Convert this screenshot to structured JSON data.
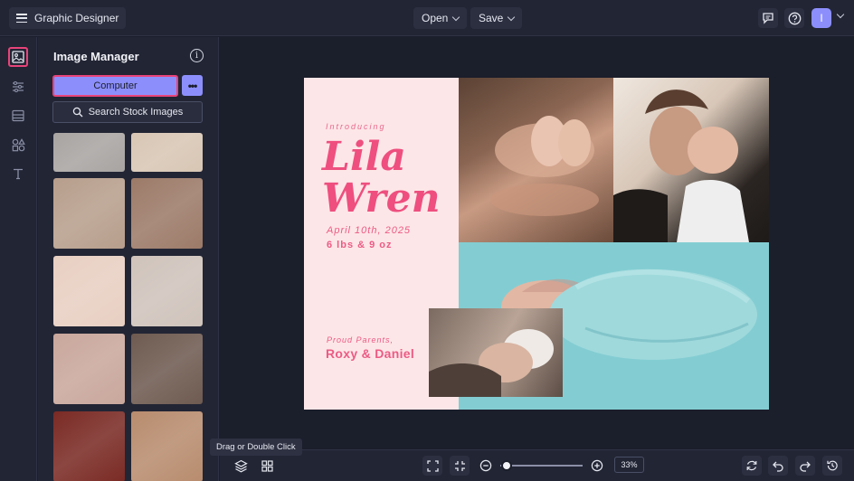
{
  "topbar": {
    "app_title": "Graphic Designer",
    "open_label": "Open",
    "save_label": "Save",
    "avatar_initial": "I"
  },
  "rail": {
    "items": [
      "image-manager",
      "adjustments",
      "layouts",
      "graphics",
      "text"
    ]
  },
  "panel": {
    "title": "Image Manager",
    "computer_label": "Computer",
    "more_label": "•••",
    "search_label": "Search Stock Images",
    "thumbnails": [
      {
        "name": "baby-sleeping-thumb",
        "color": "#a8a4a2"
      },
      {
        "name": "baby-feet-blanket-thumb",
        "color": "#d8c6b4"
      },
      {
        "name": "parents-with-baby-thumb",
        "color": "#b79e8c"
      },
      {
        "name": "hands-holding-feet-thumb",
        "color": "#9c7a68"
      },
      {
        "name": "hands-baby-feet-thumb",
        "color": "#e8cfc2"
      },
      {
        "name": "baby-white-outfit-thumb",
        "color": "#cfc3bb"
      },
      {
        "name": "baby-feet-closeup-thumb",
        "color": "#c9a79c"
      },
      {
        "name": "mother-kissing-baby-thumb",
        "color": "#6e5a50"
      },
      {
        "name": "baby-dark-blanket-thumb",
        "color": "#7a2a24"
      },
      {
        "name": "hand-on-baby-head-thumb",
        "color": "#b88c6e"
      }
    ]
  },
  "card": {
    "intro": "Introducing",
    "first_name": "Lila",
    "last_name": "Wren",
    "date": "April 10th, 2025",
    "weight": "6 lbs & 9 oz",
    "proud": "Proud Parents,",
    "parents": "Roxy & Daniel"
  },
  "bottombar": {
    "tooltip": "Drag or Double Click",
    "zoom": "33%",
    "zoom_level": 0.06
  },
  "colors": {
    "accent": "#8c8ffb",
    "highlight": "#e8437a",
    "card_bg": "#fde6e7",
    "card_text": "#ee4f7f"
  }
}
